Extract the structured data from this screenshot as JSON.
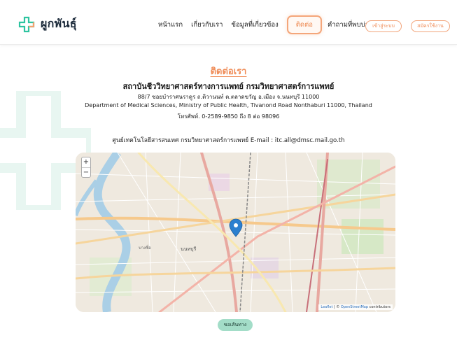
{
  "brand": {
    "name": "ผูกพันธุ์",
    "accent": "#ef8c58",
    "cross_teal": "#2ec4a0",
    "cross_orange": "#f4a06e"
  },
  "nav": {
    "items": [
      {
        "label": "หน้าแรก",
        "active": false
      },
      {
        "label": "เกี่ยวกับเรา",
        "active": false
      },
      {
        "label": "ข้อมูลที่เกี่ยวข้อง",
        "active": false
      },
      {
        "label": "ติดต่อ",
        "active": true
      },
      {
        "label": "คำถามที่พบบ่อย",
        "active": false
      }
    ],
    "login_label": "เข้าสู่ระบบ",
    "register_label": "สมัครใช้งาน"
  },
  "contact": {
    "title": "ติดต่อเรา",
    "org_name": "สถาบันชีววิทยาศาสตร์ทางการแพทย์ กรมวิทยาศาสตร์การแพทย์",
    "address_th": "88/7 ซอยบำราศนราดูร ถ.ติวานนท์ ต.ตลาดขวัญ อ.เมือง จ.นนทบุรี 11000",
    "address_en": "Department of Medical Sciences, Ministry of Public Health, Tivanond Road Nonthaburi 11000, Thailand",
    "phone": "โทรศัพท์. 0-2589-9850 ถึง 8 ต่อ 98096",
    "info_center": "ศูนย์เทคโนโลยีสารสนเทศ กรมวิทยาศาสตร์การแพทย์ E-mail : itc.all@dmsc.mail.go.th"
  },
  "map": {
    "zoom_in": "+",
    "zoom_out": "−",
    "attribution_prefix": "Leaflet",
    "attribution_sep": " | © ",
    "attribution_link": "OpenStreetMap",
    "attribution_suffix": " contributors",
    "marker_color": "#2b7fcf",
    "labels": [
      "นนทบุรี",
      "บางซื่อ"
    ]
  },
  "route_button": "ขอเส้นทาง"
}
